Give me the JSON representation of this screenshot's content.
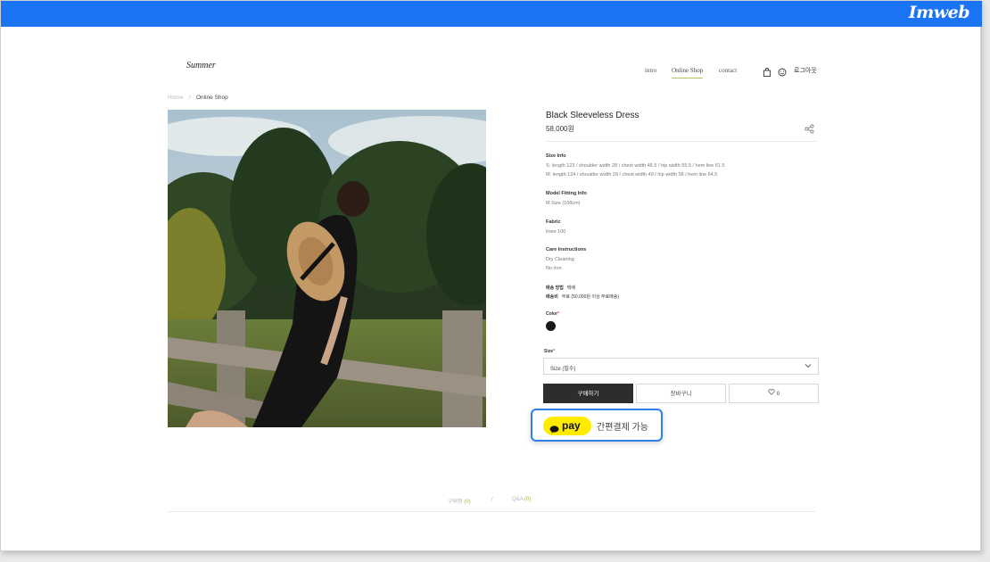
{
  "topbar": {
    "brand": "Imweb"
  },
  "header": {
    "logo": "Summer",
    "nav": [
      "intro",
      "Online Shop",
      "contact"
    ],
    "login": "로그아웃",
    "icons": [
      "shopping-bag-icon",
      "smile-icon"
    ]
  },
  "breadcrumb": {
    "home": "Home",
    "separator": "/",
    "current": "Online Shop"
  },
  "product": {
    "name": "Black Sleeveless Dress",
    "price": "58,000원",
    "sections": [
      {
        "heading": "Size Info",
        "lines": [
          "S: length 123 / shoulder width 28 / chest width 46.5 / hip width 55.5 / hem line 61.5",
          "M: length 124 / shoulder width 29 / chest width 49 / hip width 58 / hem line 64.5"
        ]
      },
      {
        "heading": "Model Fitting Info",
        "lines": [
          "M Size (168cm)"
        ]
      },
      {
        "heading": "Fabric",
        "lines": [
          "linen 100"
        ]
      },
      {
        "heading": "Care Instructions",
        "lines": [
          "Dry Cleaning",
          "No iron"
        ]
      }
    ],
    "shipping": {
      "method_label": "배송 방법",
      "method_value": "택배",
      "fee_label": "배송비",
      "fee_value": "무료 (50,000원 이상 무료배송)"
    },
    "color": {
      "label": "Color",
      "required_mark": "*",
      "swatch": "#1a1a1a"
    },
    "size": {
      "label": "Size",
      "required_mark": "*",
      "selected": "Size (필수)"
    },
    "buttons": {
      "buy": "구매하기",
      "cart": "장바구니",
      "wishlist_count": "0"
    }
  },
  "kakaopay": {
    "logo_text": "pay",
    "text": "간편결제 가능",
    "pill_color": "#ffeb00"
  },
  "tabs": [
    {
      "label": "구매평",
      "count": "(0)"
    },
    {
      "separator": "/"
    },
    {
      "label": "Q&A",
      "count": "(0)"
    }
  ],
  "colors": {
    "topbar": "#1b74f3",
    "accent": "#a7b446",
    "highlight_border": "#2f80ed"
  }
}
